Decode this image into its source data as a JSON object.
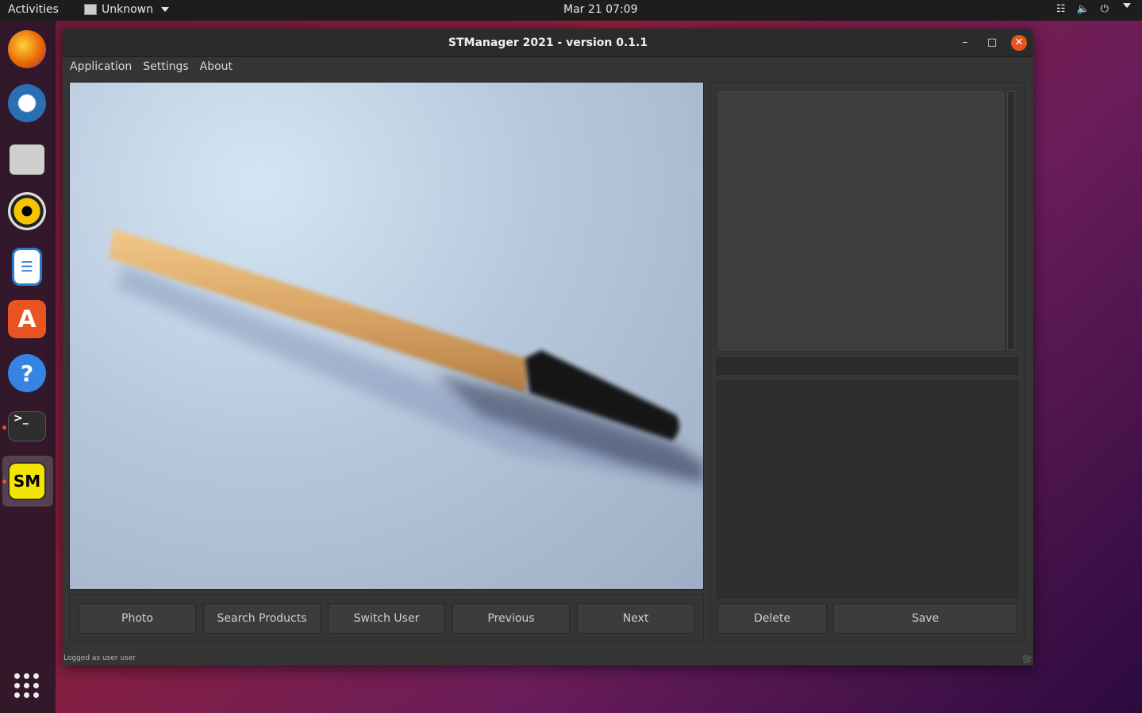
{
  "topbar": {
    "activities": "Activities",
    "app_menu": "Unknown",
    "clock": "Mar 21  07:09"
  },
  "dock": {
    "items": [
      {
        "name": "firefox-icon",
        "color": "#e66000"
      },
      {
        "name": "thunderbird-icon",
        "color": "#2a6fb3"
      },
      {
        "name": "files-icon",
        "color": "#cfcfcf"
      },
      {
        "name": "rhythmbox-icon",
        "color": "#f5c400"
      },
      {
        "name": "libreoffice-writer-icon",
        "color": "#2a7bd0"
      },
      {
        "name": "ubuntu-software-icon",
        "color": "#e95420"
      },
      {
        "name": "help-icon",
        "color": "#3584e4"
      },
      {
        "name": "terminal-icon",
        "color": "#2e2e2e"
      },
      {
        "name": "stmanager-icon",
        "color": "#f2e600"
      }
    ]
  },
  "window": {
    "title": "STManager 2021 - version 0.1.1",
    "menu": [
      "Application",
      "Settings",
      "About"
    ],
    "buttons": {
      "photo": "Photo",
      "search_products": "Search Products",
      "switch_user": "Switch User",
      "previous": "Previous",
      "next": "Next",
      "delete": "Delete",
      "save": "Save"
    },
    "status": "Logged as user user"
  }
}
